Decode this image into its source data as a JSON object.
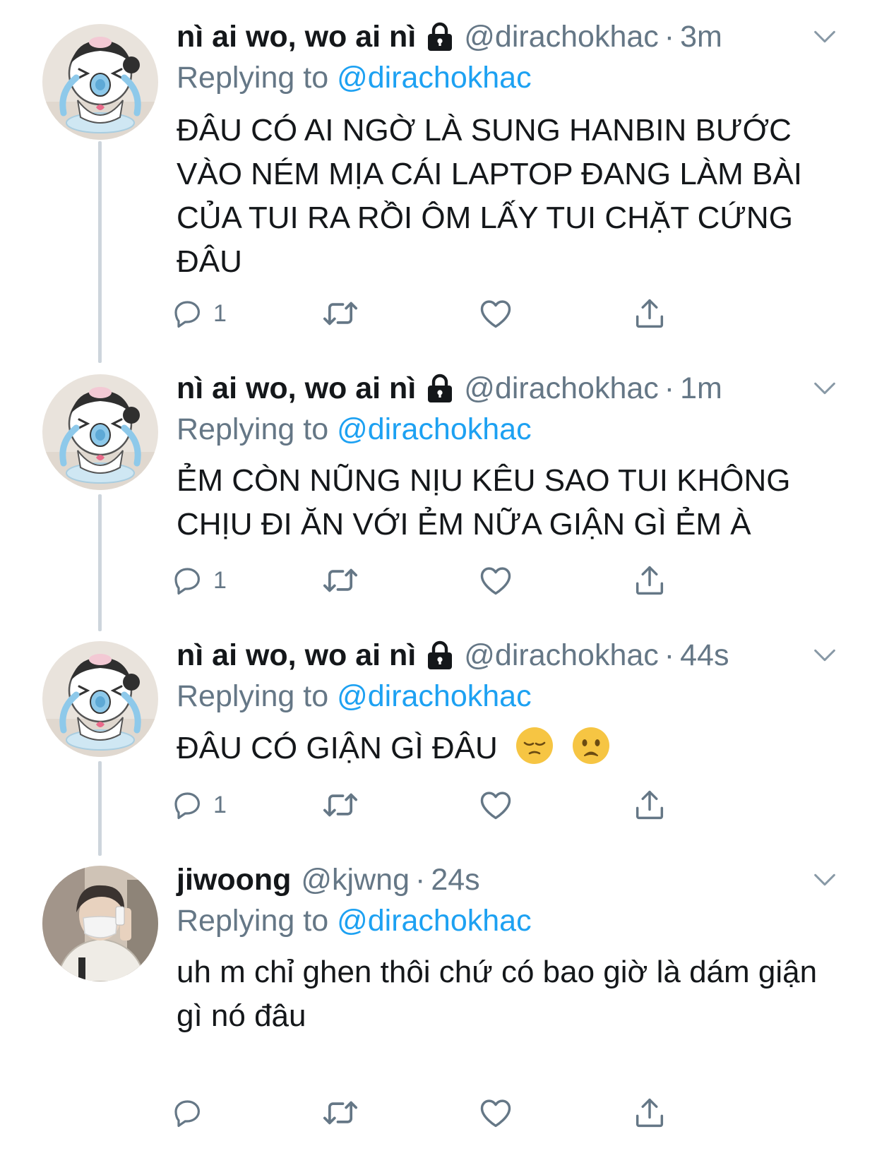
{
  "tweets": [
    {
      "name": "nì ai wo, wo ai nì",
      "handle": "@dirachokhac",
      "dot": "·",
      "time": "3m",
      "replying_prefix": "Replying to ",
      "replying_to": "@dirachokhac",
      "text": "ĐÂU CÓ AI NGỜ LÀ SUNG HANBIN BƯỚC VÀO NÉM MỊA CÁI LAPTOP ĐANG LÀM BÀI CỦA TUI RA RỒI ÔM LẤY TUI CHẶT CỨNG ĐÂU",
      "reply_count": "1",
      "locked": true,
      "avatar": "crying-cartoon-avatar"
    },
    {
      "name": "nì ai wo, wo ai nì",
      "handle": "@dirachokhac",
      "dot": "·",
      "time": "1m",
      "replying_prefix": "Replying to ",
      "replying_to": "@dirachokhac",
      "text": "ẺM CÒN NŨNG NỊU KÊU SAO TUI KHÔNG CHỊU ĐI ĂN VỚI ẺM NỮA GIẬN GÌ ẺM À",
      "reply_count": "1",
      "locked": true,
      "avatar": "crying-cartoon-avatar"
    },
    {
      "name": "nì ai wo, wo ai nì",
      "handle": "@dirachokhac",
      "dot": "·",
      "time": "44s",
      "replying_prefix": "Replying to ",
      "replying_to": "@dirachokhac",
      "text": "ĐÂU CÓ GIẬN GÌ ĐÂU",
      "emojis": [
        "pensive-face",
        "frowning-face"
      ],
      "reply_count": "1",
      "locked": true,
      "avatar": "crying-cartoon-avatar"
    },
    {
      "name": "jiwoong",
      "handle": "@kjwng",
      "dot": "·",
      "time": "24s",
      "replying_prefix": "Replying to ",
      "replying_to": "@dirachokhac",
      "text": "uh m chỉ ghen thôi chứ có bao giờ là dám giận gì nó đâu",
      "reply_count": "",
      "locked": false,
      "avatar": "person-photo-avatar"
    }
  ],
  "colors": {
    "link": "#1da1f2",
    "secondary": "#657786",
    "text": "#14171a",
    "thread_line": "#cdd5dc"
  },
  "icons": [
    "reply-icon",
    "retweet-icon",
    "like-icon",
    "share-icon",
    "chevron-down-icon",
    "lock-icon"
  ]
}
